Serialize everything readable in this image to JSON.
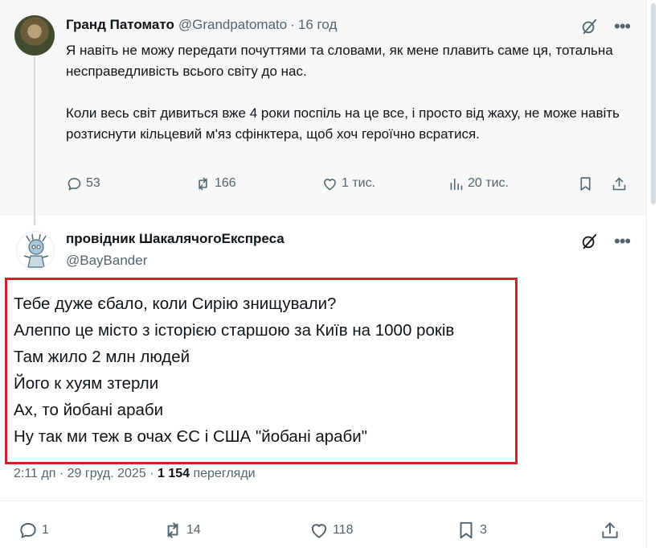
{
  "parent": {
    "author_name": "Гранд Патомато",
    "handle": "@Grandpatomato",
    "time_ago": "16 год",
    "paragraphs": [
      "Я навіть не можу передати почуттями та словами, як мене плавить саме ця, тотальна несправедливість всього світу до нас.",
      "Коли весь світ дивиться вже 4 роки поспіль на це все, і просто від жаху, не може навіть розтиснути кільцевий м'яз сфінктера, щоб хоч героїчно всратися."
    ],
    "replies": "53",
    "reposts": "166",
    "likes": "1 тис.",
    "views": "20 тис."
  },
  "reply": {
    "author_name": "провідник ШакалячогоЕкспреса",
    "handle": "@BayBander",
    "lines": [
      "Тебе дуже єбало, коли Сирію знищували?",
      "Алеппо це місто з історією старшою за Київ на 1000 років",
      "Там жило 2 млн людей",
      "Його к хуям зтерли",
      "Ах, то йобані араби",
      "Ну так ми теж в очах ЄС і США \"йобані араби\""
    ],
    "time": "2:11 дп",
    "date": "29 груд. 2025",
    "views_count": "1 154",
    "views_label": "перегляди",
    "replies": "1",
    "reposts": "14",
    "likes": "118",
    "bookmarks": "3"
  },
  "icons": {
    "grok": "grok-icon",
    "more": "more-icon",
    "reply": "reply-icon",
    "repost": "repost-icon",
    "like": "heart-icon",
    "views": "views-icon",
    "bookmark": "bookmark-icon",
    "share": "share-icon"
  },
  "colors": {
    "highlight_border": "#d0212b",
    "secondary_text": "#536471",
    "primary_text": "#0f1419",
    "parent_background": "#f7f7f7"
  }
}
